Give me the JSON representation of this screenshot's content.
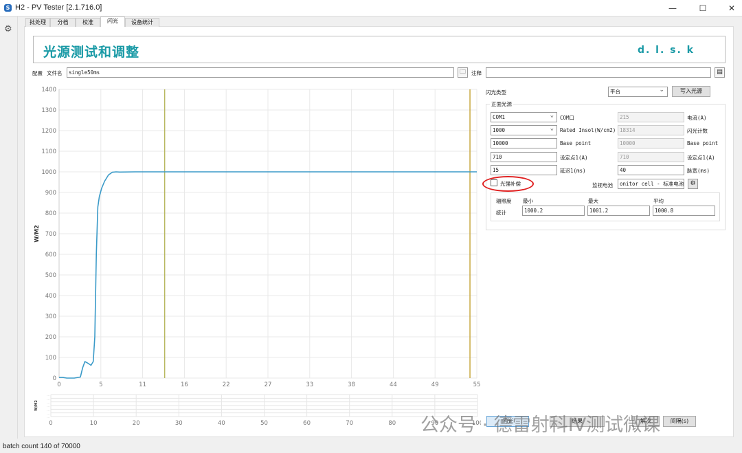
{
  "window": {
    "title": "H2 - PV Tester [2.1.716.0]",
    "logo": "S"
  },
  "tabs": [
    {
      "label": "批处理"
    },
    {
      "label": "分档"
    },
    {
      "label": "校准"
    },
    {
      "label": "闪光",
      "active": true
    },
    {
      "label": "设备统计"
    }
  ],
  "header": {
    "title": "光源测试和调整",
    "brand": "d. l. s. k"
  },
  "file_row": {
    "config_label": "配置",
    "filename_label": "文件名",
    "filename_value": "single50ms",
    "note_label": "注释",
    "note_value": ""
  },
  "flash": {
    "type_label": "闪光类型",
    "type_value": "平台",
    "write_button": "写入光源",
    "group_title": "正面光源",
    "rows": [
      {
        "f1": "COM1",
        "f1_select": true,
        "l1": "COM口",
        "f2": "215",
        "l2": "电流(A)"
      },
      {
        "f1": "1000",
        "f1_select": true,
        "l1": "Rated Insol(W/cm2)",
        "f2": "18314",
        "l2": "闪光计数"
      },
      {
        "f1": "10000",
        "l1": "Base point",
        "f2": "10000",
        "l2": "Base point"
      },
      {
        "f1": "710",
        "l1": "设定点1(A)",
        "f2": "710",
        "l2": "设定点1(A)"
      },
      {
        "f1": "15",
        "l1": "延迟1(ms)",
        "f2": "40",
        "f2_enabled": true,
        "l2": "脉宽(ms)"
      }
    ],
    "compensation_label": "光强补偿",
    "compensation_checked": false,
    "monitor_label": "监视电池",
    "monitor_value": "onitor cell - 标准电池",
    "stats": {
      "row_header": "辐照度",
      "min_label": "最小",
      "max_label": "最大",
      "avg_label": "平均",
      "row_label": "统计",
      "min": "1000.2",
      "max": "1001.2",
      "avg": "1000.8"
    },
    "highlight_color": "#e02020"
  },
  "bottom_buttons": {
    "flash": "闪光",
    "result": "结果",
    "unlock": "解次",
    "interval": "间隔(s)"
  },
  "watermark": "公众号 · 德雷射科IV测试微课",
  "status": "batch count 140 of 70000",
  "chart_data": [
    {
      "type": "line",
      "ylabel": "W/M2",
      "xlim": [
        0,
        55
      ],
      "ylim": [
        0,
        1400
      ],
      "grid": true,
      "xticks": [
        "0",
        "5",
        "11",
        "16",
        "22",
        "27",
        "33",
        "38",
        "44",
        "49",
        "55"
      ],
      "yticks": [
        0,
        100,
        200,
        300,
        400,
        500,
        600,
        700,
        800,
        900,
        1000,
        1100,
        1200,
        1300,
        1400
      ],
      "series": [
        {
          "color": "#3a9ac8",
          "x": [
            0,
            0.5,
            1,
            2,
            2.8,
            3.1,
            3.4,
            3.8,
            4.2,
            4.5,
            4.7,
            4.9,
            5.1,
            5.3,
            5.6,
            6.0,
            6.5,
            7.0,
            7.5,
            8,
            10,
            15,
            20,
            30,
            40,
            50,
            55
          ],
          "y": [
            3,
            3,
            0,
            0,
            5,
            50,
            80,
            72,
            62,
            80,
            200,
            600,
            830,
            880,
            920,
            955,
            985,
            998,
            1000,
            999,
            1000,
            1000,
            1000,
            1000,
            1000,
            1000,
            1000
          ]
        }
      ],
      "markers": [
        {
          "x": 13.9,
          "color": "#b8b860"
        },
        {
          "x": 54.1,
          "color": "#c8a840"
        }
      ]
    },
    {
      "type": "line",
      "ylabel": "W/M2",
      "xlim": [
        0,
        100
      ],
      "xticks": [
        "0",
        "10",
        "20",
        "30",
        "40",
        "50",
        "60",
        "70",
        "80",
        "90",
        "100"
      ],
      "grid": true,
      "series": []
    }
  ]
}
